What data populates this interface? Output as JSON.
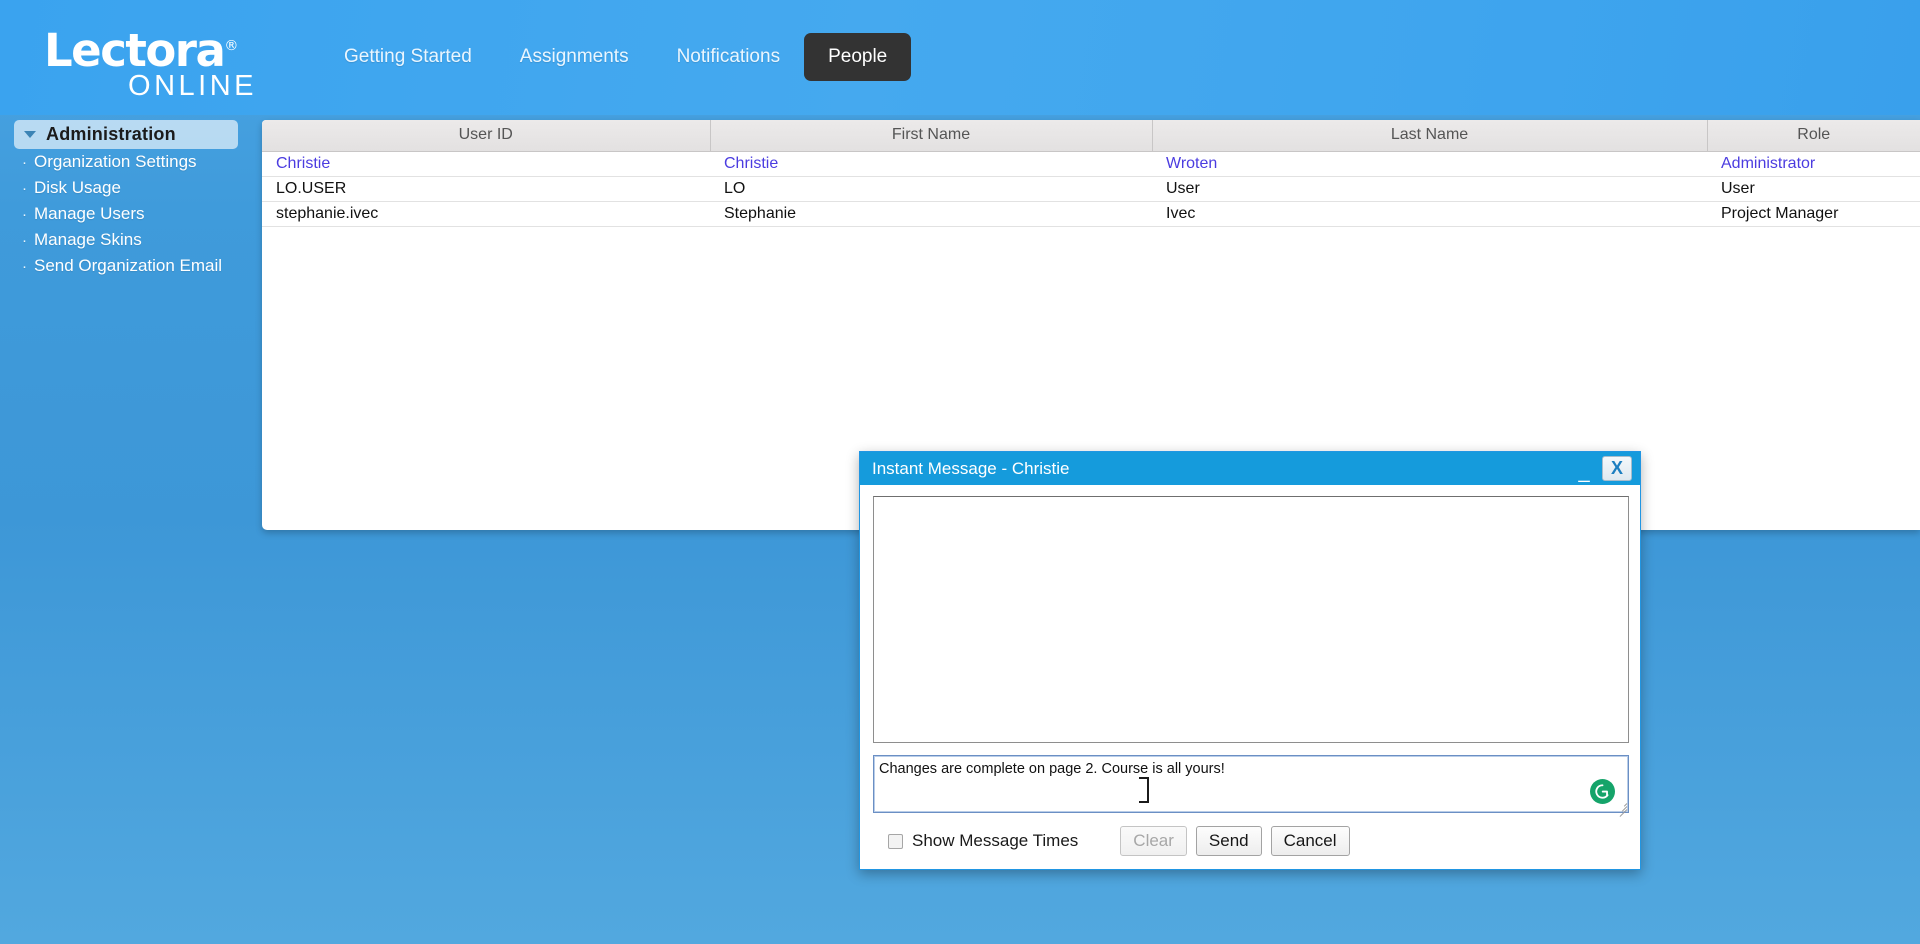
{
  "header": {
    "logo": {
      "main": "Lectora",
      "registered": "®",
      "sub": "ONLINE"
    },
    "nav": [
      {
        "label": "Getting Started",
        "active": false
      },
      {
        "label": "Assignments",
        "active": false
      },
      {
        "label": "Notifications",
        "active": false
      },
      {
        "label": "People",
        "active": true
      }
    ]
  },
  "sidebar": {
    "section_title": "Administration",
    "chevron_icon": "chevron-down-icon",
    "items": [
      {
        "label": "Organization Settings"
      },
      {
        "label": "Disk Usage"
      },
      {
        "label": "Manage Users"
      },
      {
        "label": "Manage Skins"
      },
      {
        "label": "Send Organization Email"
      }
    ]
  },
  "people_table": {
    "columns": [
      "User ID",
      "First Name",
      "Last Name",
      "Role"
    ],
    "rows": [
      {
        "cells": [
          "Christie",
          "Christie",
          "Wroten",
          "Administrator"
        ],
        "visited": true
      },
      {
        "cells": [
          "LO.USER",
          "LO",
          "User",
          "User"
        ],
        "visited": false
      },
      {
        "cells": [
          "stephanie.ivec",
          "Stephanie",
          "Ivec",
          "Project Manager"
        ],
        "visited": false
      }
    ]
  },
  "instant_message_dialog": {
    "title": "Instant Message - Christie",
    "minimize_icon": "minimize-icon",
    "close_icon": "close-icon",
    "transcript": "",
    "compose_value": "Changes are complete on page 2. Course is all yours!",
    "compose_placeholder": "",
    "grammarly_icon": "grammarly-icon",
    "resize_grip_icon": "resize-grip-icon",
    "text_cursor_icon": "text-cursor-icon",
    "checkbox": {
      "label": "Show Message Times",
      "checked": false
    },
    "buttons": [
      {
        "label": "Clear",
        "disabled": true
      },
      {
        "label": "Send",
        "disabled": false
      },
      {
        "label": "Cancel",
        "disabled": false
      }
    ]
  },
  "colors": {
    "page_background": "#3d97d7",
    "header_background": "#3fa5ee",
    "active_tab_background": "#333333",
    "dialog_titlebar": "#159bdc",
    "visited_link": "#4b3ce0",
    "grammarly_green": "#15a46a"
  }
}
